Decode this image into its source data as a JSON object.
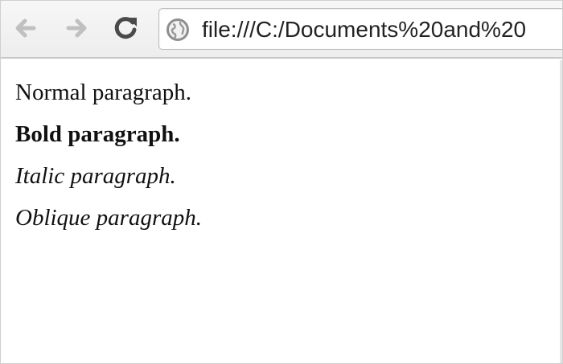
{
  "toolbar": {
    "back_icon": "back-arrow-icon",
    "forward_icon": "forward-arrow-icon",
    "reload_icon": "reload-icon",
    "globe_icon": "globe-icon",
    "url": "file:///C:/Documents%20and%20"
  },
  "content": {
    "paragraphs": [
      {
        "text": "Normal paragraph.",
        "style": "normal"
      },
      {
        "text": "Bold paragraph.",
        "style": "bold"
      },
      {
        "text": "Italic paragraph.",
        "style": "italic"
      },
      {
        "text": "Oblique paragraph.",
        "style": "oblique"
      }
    ]
  },
  "colors": {
    "toolbar_bg": "#f2f2f2",
    "icon_disabled": "#b9b9b9",
    "icon_active": "#4a4a4a",
    "text": "#111111"
  }
}
